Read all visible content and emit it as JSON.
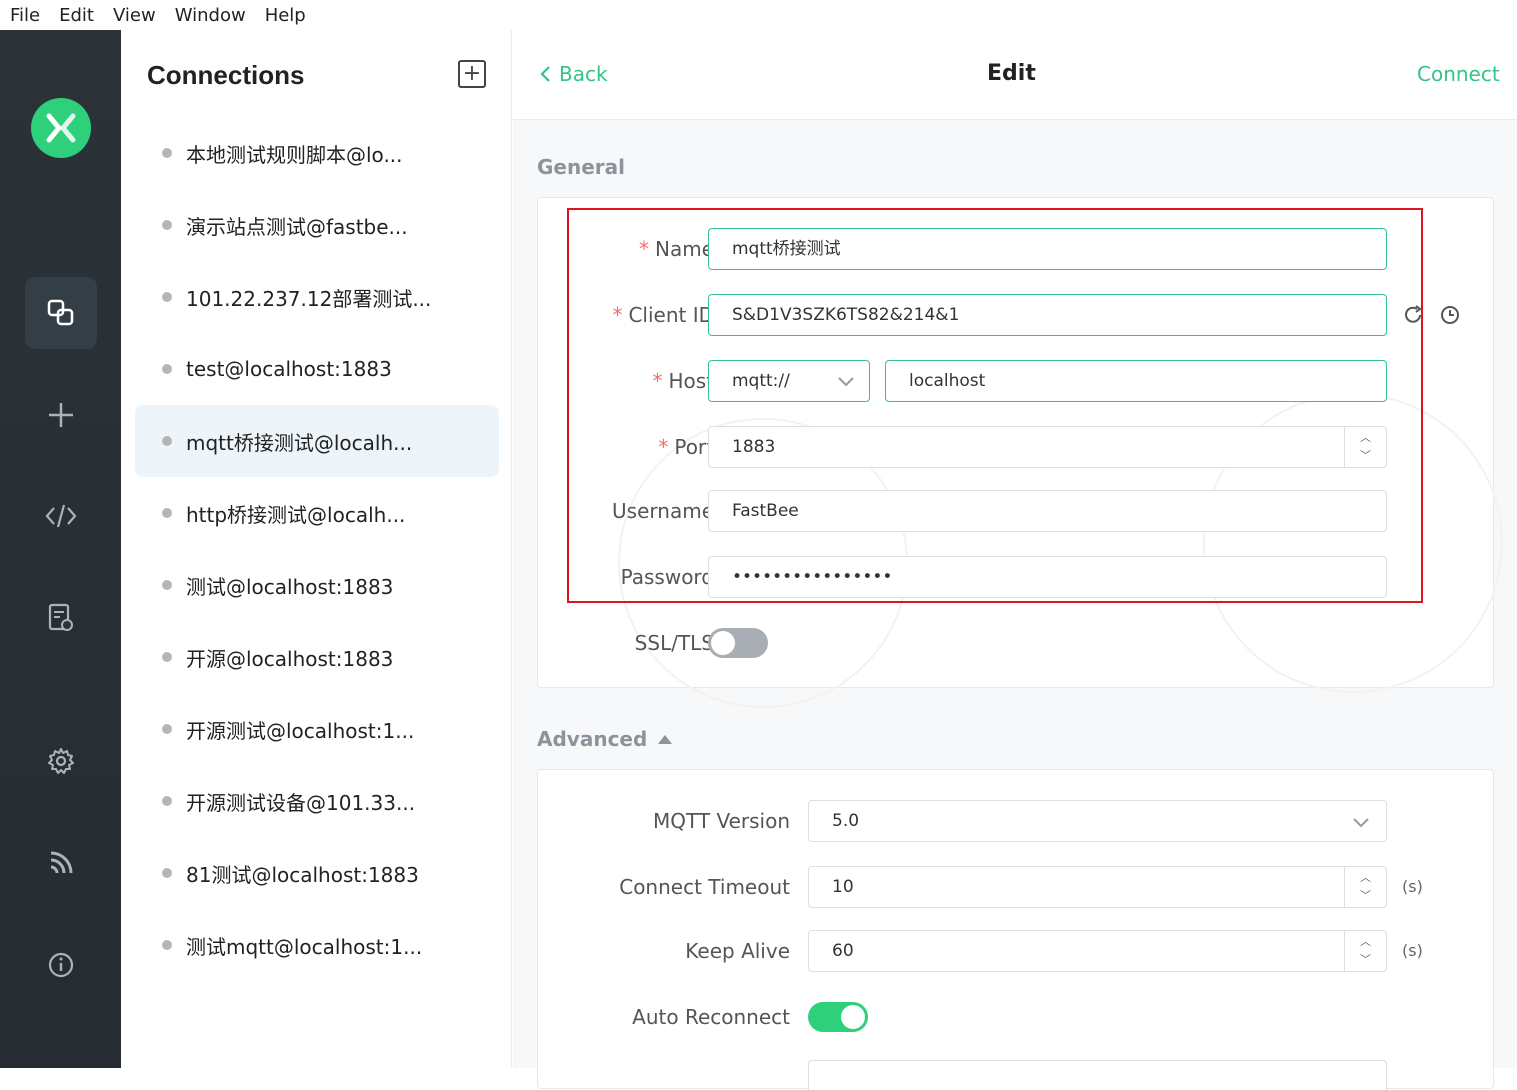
{
  "menu": [
    "File",
    "Edit",
    "View",
    "Window",
    "Help"
  ],
  "sidebar": {
    "title": "Connections",
    "connections": [
      "本地测试规则脚本@lo...",
      "演示站点测试@fastbe...",
      "101.22.237.12部署测试...",
      "test@localhost:1883",
      "mqtt桥接测试@localh...",
      "http桥接测试@localh...",
      "测试@localhost:1883",
      "开源@localhost:1883",
      "开源测试@localhost:1...",
      "开源测试设备@101.33...",
      "81测试@localhost:1883",
      "测试mqtt@localhost:1..."
    ],
    "selected_index": 4
  },
  "header": {
    "back_label": "Back",
    "title": "Edit",
    "connect_label": "Connect"
  },
  "general": {
    "title": "General",
    "name_label": "Name",
    "name_value": "mqtt桥接测试",
    "client_id_label": "Client ID",
    "client_id_value": "S&D1V3SZK6TS82&214&1",
    "host_label": "Host",
    "protocol_value": "mqtt://",
    "host_value": "localhost",
    "port_label": "Port",
    "port_value": "1883",
    "username_label": "Username",
    "username_value": "FastBee",
    "password_label": "Password",
    "password_value": "••••••••••••••••",
    "ssl_label": "SSL/TLS",
    "ssl_on": false
  },
  "advanced": {
    "title": "Advanced",
    "mqtt_version_label": "MQTT Version",
    "mqtt_version_value": "5.0",
    "connect_timeout_label": "Connect Timeout",
    "connect_timeout_value": "10",
    "keep_alive_label": "Keep Alive",
    "keep_alive_value": "60",
    "unit": "(s)",
    "auto_reconnect_label": "Auto Reconnect",
    "auto_reconnect_on": true
  },
  "colors": {
    "accent": "#34c388",
    "required": "#f56c6c",
    "highlight_box": "#e0141e",
    "sidebar_bg": "#2b3338"
  }
}
